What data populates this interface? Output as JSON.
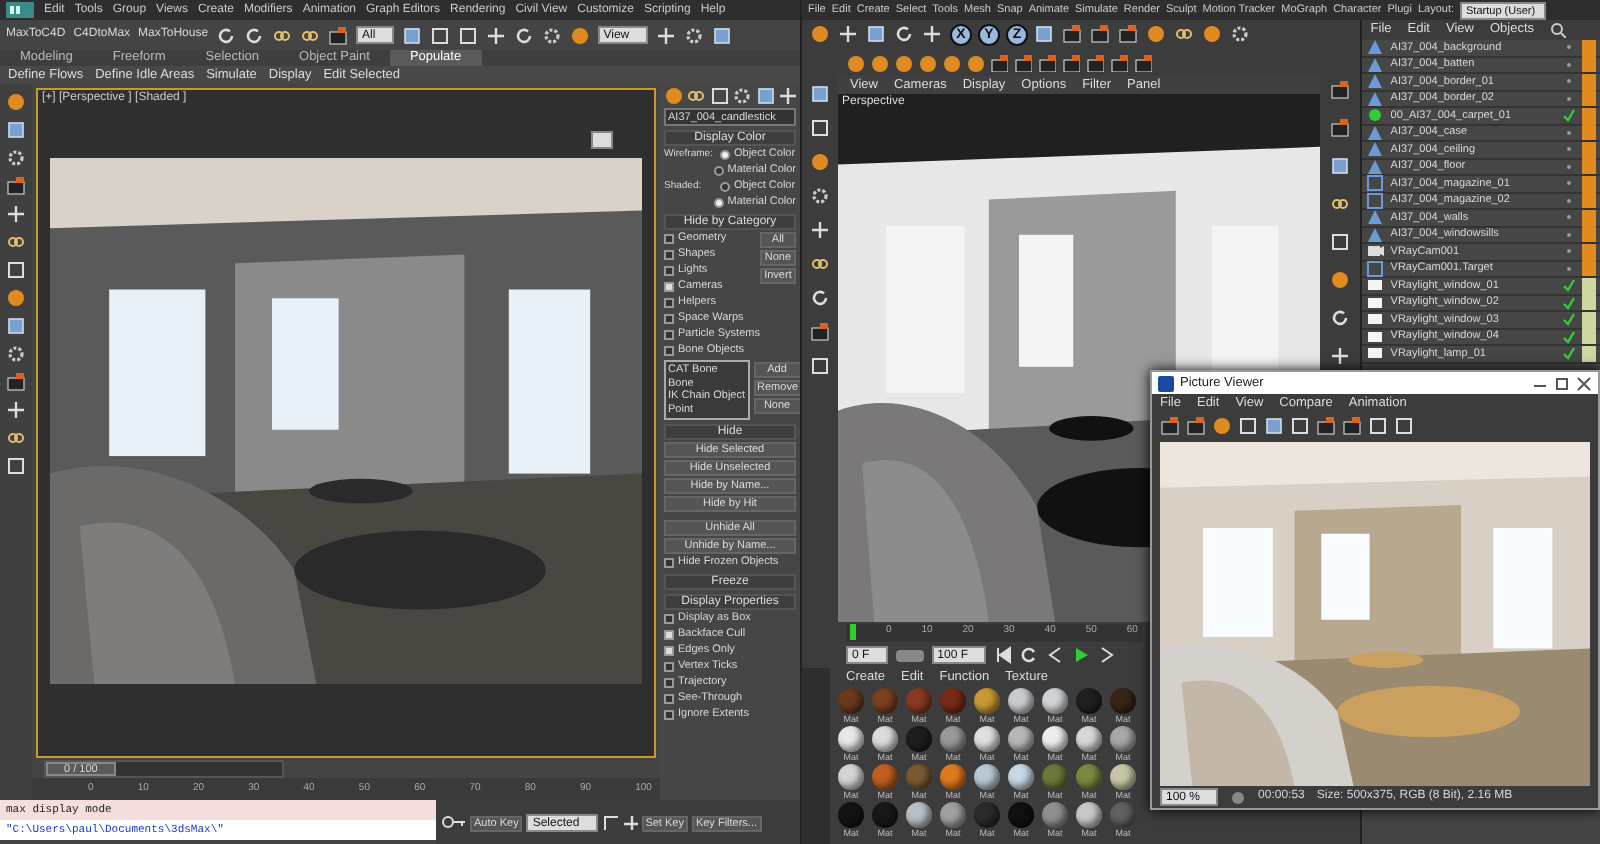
{
  "max": {
    "menu": [
      "Edit",
      "Tools",
      "Group",
      "Views",
      "Create",
      "Modifiers",
      "Animation",
      "Graph Editors",
      "Rendering",
      "Civil View",
      "Customize",
      "Scripting",
      "Help"
    ],
    "quick_buttons": [
      "MaxToC4D",
      "C4DtoMax",
      "MaxToHouse"
    ],
    "selection_filter": "All",
    "coordinate_system": "View",
    "ribbon_tabs": [
      {
        "label": "Modeling",
        "selected": false
      },
      {
        "label": "Freeform",
        "selected": false
      },
      {
        "label": "Selection",
        "selected": false
      },
      {
        "label": "Object Paint",
        "selected": false
      },
      {
        "label": "Populate",
        "selected": true
      }
    ],
    "ribbon_commands": [
      "Define Flows",
      "Define Idle Areas",
      "Simulate",
      "Display",
      "Edit Selected"
    ],
    "viewport_label": "[+] [Perspective ] [Shaded ]",
    "object_name": "AI37_004_candlestick",
    "display_color": {
      "title": "Display Color",
      "groups": [
        {
          "label": "Wireframe:",
          "options": [
            {
              "label": "Object Color",
              "selected": true
            },
            {
              "label": "Material Color",
              "selected": false
            }
          ]
        },
        {
          "label": "Shaded:",
          "options": [
            {
              "label": "Object Color",
              "selected": false
            },
            {
              "label": "Material Color",
              "selected": true
            }
          ]
        }
      ]
    },
    "hide_by_category": {
      "title": "Hide by Category",
      "categories": [
        {
          "label": "Geometry",
          "checked": false
        },
        {
          "label": "Shapes",
          "checked": false
        },
        {
          "label": "Lights",
          "checked": false
        },
        {
          "label": "Cameras",
          "checked": true
        },
        {
          "label": "Helpers",
          "checked": false
        },
        {
          "label": "Space Warps",
          "checked": false
        },
        {
          "label": "Particle Systems",
          "checked": false
        },
        {
          "label": "Bone Objects",
          "checked": false
        }
      ],
      "buttons": [
        "All",
        "None",
        "Invert"
      ],
      "list": [
        "CAT Bone",
        "Bone",
        "IK Chain Object",
        "Point"
      ],
      "list_buttons": [
        "Add",
        "Remove",
        "None"
      ]
    },
    "hide": {
      "title": "Hide",
      "buttons": [
        "Hide Selected",
        "Hide Unselected",
        "Hide by Name...",
        "Hide by Hit"
      ],
      "unhide_buttons": [
        "Unhide All",
        "Unhide by Name..."
      ],
      "option": {
        "label": "Hide Frozen Objects",
        "checked": false
      }
    },
    "freeze": {
      "title": "Freeze"
    },
    "display_properties": {
      "title": "Display Properties",
      "options": [
        {
          "label": "Display as Box",
          "checked": false
        },
        {
          "label": "Backface Cull",
          "checked": true
        },
        {
          "label": "Edges Only",
          "checked": true
        },
        {
          "label": "Vertex Ticks",
          "checked": false
        },
        {
          "label": "Trajectory",
          "checked": false
        },
        {
          "label": "See-Through",
          "checked": false
        },
        {
          "label": "Ignore Extents",
          "checked": false
        }
      ]
    },
    "time_slider": {
      "label": "0 / 100",
      "level": 0
    },
    "ticks": [
      "0",
      "10",
      "20",
      "30",
      "40",
      "50",
      "60",
      "70",
      "80",
      "90",
      "100"
    ],
    "listener": {
      "command": "max display mode",
      "output": "\"C:\\Users\\paul\\Documents\\3dsMax\\\""
    },
    "auto_key": "Auto Key",
    "set_key": "Set Key",
    "key_mode": "Selected",
    "key_filters": "Key Filters..."
  },
  "c4d": {
    "menu": [
      "File",
      "Edit",
      "Create",
      "Select",
      "Tools",
      "Mesh",
      "Snap",
      "Animate",
      "Simulate",
      "Render",
      "Sculpt",
      "Motion Tracker",
      "MoGraph",
      "Character",
      "Plugi"
    ],
    "layout_label": "Layout:",
    "layout": "Startup (User)",
    "axis_buttons": [
      "X",
      "Y",
      "Z"
    ],
    "viewport_menu": [
      "View",
      "Cameras",
      "Display",
      "Options",
      "Filter",
      "Panel"
    ],
    "viewport_label": "Perspective",
    "object_menu": [
      "File",
      "Edit",
      "View",
      "Objects"
    ],
    "objects": [
      {
        "name": "AI37_004_background",
        "kind": "mesh",
        "check": false
      },
      {
        "name": "AI37_004_batten",
        "kind": "mesh",
        "check": false
      },
      {
        "name": "AI37_004_border_01",
        "kind": "mesh",
        "check": false
      },
      {
        "name": "AI37_004_border_02",
        "kind": "mesh",
        "check": false
      },
      {
        "name": "00_AI37_004_carpet_01",
        "kind": "null",
        "check": true
      },
      {
        "name": "AI37_004_case",
        "kind": "mesh",
        "check": false
      },
      {
        "name": "AI37_004_ceiling",
        "kind": "mesh",
        "check": false
      },
      {
        "name": "AI37_004_floor",
        "kind": "mesh",
        "check": false
      },
      {
        "name": "AI37_004_magazine_01",
        "kind": "instance",
        "check": false
      },
      {
        "name": "AI37_004_magazine_02",
        "kind": "instance",
        "check": false
      },
      {
        "name": "AI37_004_walls",
        "kind": "mesh",
        "check": false
      },
      {
        "name": "AI37_004_windowsills",
        "kind": "mesh",
        "check": false
      },
      {
        "name": "VRayCam001",
        "kind": "camera",
        "check": false
      },
      {
        "name": "VRayCam001.Target",
        "kind": "instance",
        "check": false
      },
      {
        "name": "VRaylight_window_01",
        "kind": "light",
        "check": true
      },
      {
        "name": "VRaylight_window_02",
        "kind": "light",
        "check": true
      },
      {
        "name": "VRaylight_window_03",
        "kind": "light",
        "check": true
      },
      {
        "name": "VRaylight_window_04",
        "kind": "light",
        "check": true
      },
      {
        "name": "VRaylight_lamp_01",
        "kind": "light",
        "check": true
      }
    ],
    "timeline_ticks": [
      "0",
      "10",
      "20",
      "30",
      "40",
      "50",
      "60"
    ],
    "time_start": "0 F",
    "time_end": "100 F",
    "material_menu": [
      "Create",
      "Edit",
      "Function",
      "Texture"
    ],
    "materials": [
      {
        "label": "Mat",
        "color": "#6b3a1e"
      },
      {
        "label": "Mat",
        "color": "#7a4020"
      },
      {
        "label": "Mat",
        "color": "#8a3a20"
      },
      {
        "label": "Mat",
        "color": "#7a2a18"
      },
      {
        "label": "Mat",
        "color": "#c89a30"
      },
      {
        "label": "Mat",
        "color": "#c8ccd0"
      },
      {
        "label": "Mat",
        "color": "#d0d4d8"
      },
      {
        "label": "Mat",
        "color": "#202020"
      },
      {
        "label": "Mat",
        "color": "#3a2418"
      },
      {
        "label": "Mat",
        "color": "#e8e8e8"
      },
      {
        "label": "Mat",
        "color": "#dcdcdc"
      },
      {
        "label": "Mat",
        "color": "#1e1e1e"
      },
      {
        "label": "Mat",
        "color": "#9a9a9a"
      },
      {
        "label": "Mat",
        "color": "#e0e0e0"
      },
      {
        "label": "Mat",
        "color": "#b8b8b8"
      },
      {
        "label": "Mat",
        "color": "#eeeeee"
      },
      {
        "label": "Mat",
        "color": "#d8d8d8"
      },
      {
        "label": "Mat",
        "color": "#a8a8a8"
      },
      {
        "label": "Mat",
        "color": "#d4d4d4"
      },
      {
        "label": "Mat",
        "color": "#c06020"
      },
      {
        "label": "Mat",
        "color": "#7a5a30"
      },
      {
        "label": "Mat",
        "color": "#e07a20"
      },
      {
        "label": "Mat",
        "color": "#b8c8d4"
      },
      {
        "label": "Mat",
        "color": "#c8d8e4"
      },
      {
        "label": "Mat",
        "color": "#6a7a3a"
      },
      {
        "label": "Mat",
        "color": "#7a8a40"
      },
      {
        "label": "Mat",
        "color": "#c8c8a8"
      },
      {
        "label": "Mat",
        "color": "#141414"
      },
      {
        "label": "Mat",
        "color": "#181818"
      },
      {
        "label": "Mat",
        "color": "#b8c0c8"
      },
      {
        "label": "Mat",
        "color": "#a0a0a0"
      },
      {
        "label": "Mat",
        "color": "#2a2a2a"
      },
      {
        "label": "Mat",
        "color": "#101010"
      },
      {
        "label": "Mat",
        "color": "#909090"
      },
      {
        "label": "Mat",
        "color": "#c8c8c8"
      },
      {
        "label": "Mat",
        "color": "#606060"
      }
    ],
    "picture_viewer": {
      "title": "Picture Viewer",
      "menu": [
        "File",
        "Edit",
        "View",
        "Compare",
        "Animation"
      ],
      "zoom": "100 %",
      "time": "00:00:53",
      "info": "Size: 500x375, RGB (8 Bit), 2.16 MB"
    }
  }
}
